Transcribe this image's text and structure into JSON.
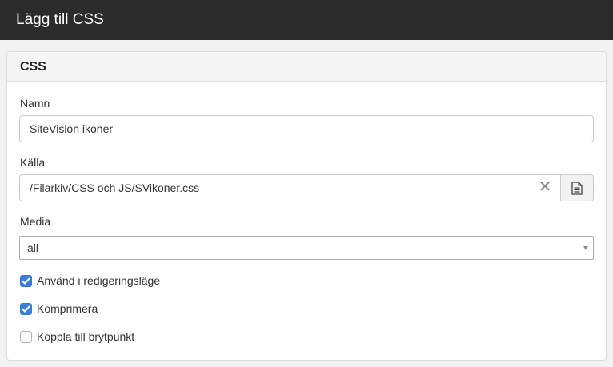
{
  "window": {
    "title": "Lägg till CSS"
  },
  "panel": {
    "heading": "CSS",
    "name": {
      "label": "Namn",
      "value": "SiteVision ikoner"
    },
    "source": {
      "label": "Källa",
      "value": "/Filarkiv/CSS och JS/SVikoner.css",
      "clear_glyph": "✕",
      "file_icon": "document-icon"
    },
    "media": {
      "label": "Media",
      "selected": "all"
    },
    "checkboxes": [
      {
        "label": "Använd i redigeringsläge",
        "checked": true
      },
      {
        "label": "Komprimera",
        "checked": true
      },
      {
        "label": "Koppla till brytpunkt",
        "checked": false
      }
    ]
  },
  "colors": {
    "titlebar": "#2b2b2b",
    "checkbox_accent": "#3d7fd6"
  }
}
